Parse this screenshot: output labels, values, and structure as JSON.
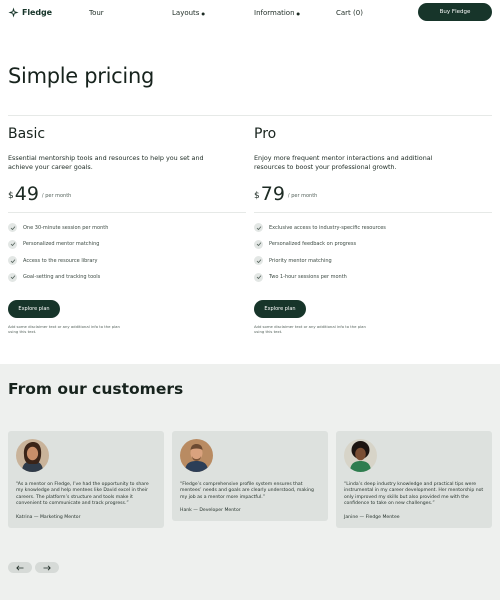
{
  "nav": {
    "brand": "Fledge",
    "links": [
      "Tour",
      "Layouts",
      "Information",
      "Cart (0)"
    ],
    "cta": "Buy Fledge"
  },
  "hero": {
    "title": "Simple pricing"
  },
  "plans": [
    {
      "name": "Basic",
      "description": "Essential mentorship tools and resources to help you set and achieve your career goals.",
      "currency": "$",
      "price": "49",
      "period": "/ per month",
      "features": [
        "One 30-minute session per month",
        "Personalized mentor matching",
        "Access to the resource library",
        "Goal-setting and tracking tools"
      ],
      "cta": "Explore plan",
      "disclaimer": "Add some disclaimer text or any additional info to the plan using this text."
    },
    {
      "name": "Pro",
      "description": "Enjoy more frequent mentor interactions and additional resources to boost your professional growth.",
      "currency": "$",
      "price": "79",
      "period": "/ per month",
      "features": [
        "Exclusive access to industry-specific resources",
        "Personalized feedback on progress",
        "Priority mentor matching",
        "Two 1-hour sessions per month"
      ],
      "cta": "Explore plan",
      "disclaimer": "Add some disclaimer text or any additional info to the plan using this text."
    }
  ],
  "testimonials": {
    "title": "From our customers",
    "items": [
      {
        "quote": "“As a mentor on Fledge, I’ve had the opportunity to share my knowledge and help mentees like David excel in their careers. The platform’s structure and tools make it convenient to communicate and track progress.”",
        "author": "Katrina — Marketing Mentor"
      },
      {
        "quote": "“Fledge’s comprehensive profile system ensures that mentees’ needs and goals are clearly understood, making my job as a mentor more impactful.”",
        "author": "Hank — Developer Mentor"
      },
      {
        "quote": "“Linda’s deep industry knowledge and practical tips were instrumental in my career development. Her mentorship not only improved my skills but also provided me with the confidence to take on new challenges.”",
        "author": "Janine — Fledge Mentee"
      }
    ]
  },
  "colors": {
    "brand": "#17352a",
    "section_bg": "#eef0ee",
    "card_bg": "#dde1de"
  },
  "icons": {
    "check": "check-icon",
    "prev": "arrow-left-icon",
    "next": "arrow-right-icon"
  }
}
